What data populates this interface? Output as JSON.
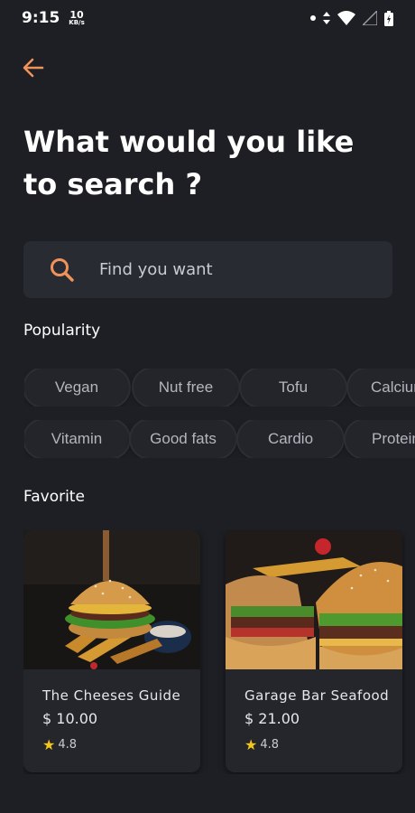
{
  "status": {
    "time": "9:15",
    "speed_value": "10",
    "speed_unit": "KB/s"
  },
  "page": {
    "title": "What would you like to search ?"
  },
  "search": {
    "placeholder": "Find you want"
  },
  "popularity": {
    "label": "Popularity",
    "row1": [
      "Vegan",
      "Nut free",
      "Tofu",
      "Calcium"
    ],
    "row2": [
      "Vitamin",
      "Good fats",
      "Cardio",
      "Protein"
    ]
  },
  "favorite": {
    "label": "Favorite",
    "items": [
      {
        "name": "The Cheeses Guide",
        "price": "$ 10.00",
        "rating": "4.8"
      },
      {
        "name": "Garage Bar Seafood",
        "price": "$ 21.00",
        "rating": "4.8"
      }
    ]
  },
  "colors": {
    "accent": "#f0935a",
    "background": "#1e1f24",
    "star": "#f5c518"
  },
  "icons": [
    "back-arrow-icon",
    "search-icon",
    "star-icon",
    "wifi-icon",
    "signal-icon",
    "battery-icon"
  ]
}
